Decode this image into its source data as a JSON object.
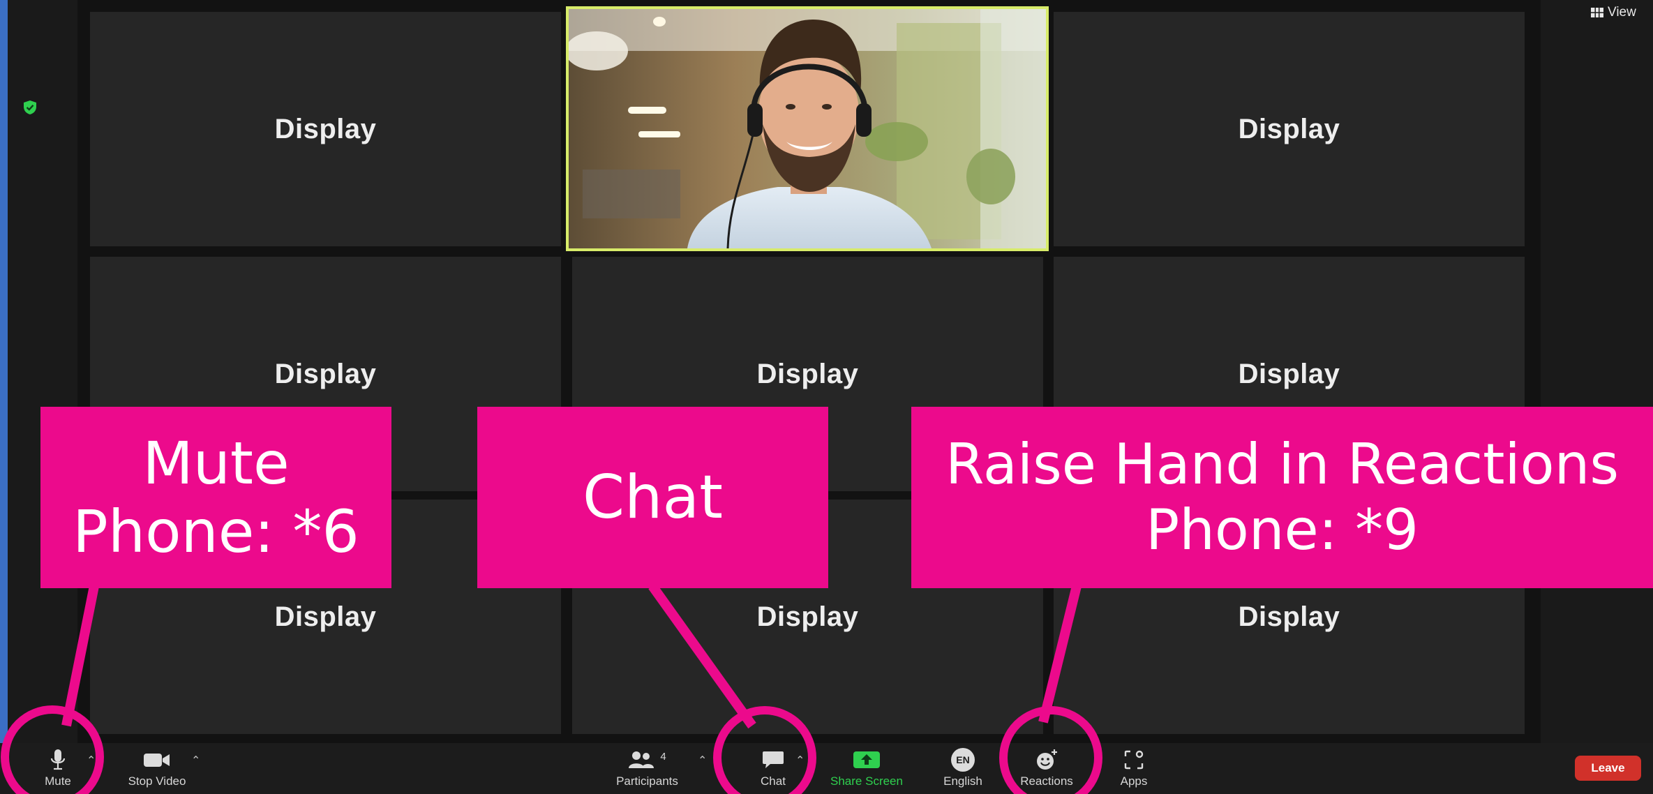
{
  "top_bar": {
    "view_label": "View",
    "view_icon": "grid-view-icon"
  },
  "tiles": [
    {
      "label": "Display"
    },
    {
      "label": "Display"
    },
    {
      "label": "Display"
    },
    {
      "label": "Display"
    },
    {
      "label": "Display"
    },
    {
      "label": "Display"
    },
    {
      "label": "Display"
    },
    {
      "label": "Display"
    }
  ],
  "active_speaker": {
    "highlight_color": "#d8ec6a"
  },
  "toolbar": {
    "mute_label": "Mute",
    "stop_video_label": "Stop Video",
    "participants_label": "Participants",
    "participants_count": "4",
    "chat_label": "Chat",
    "share_screen_label": "Share Screen",
    "language_code": "EN",
    "language_label": "English",
    "reactions_label": "Reactions",
    "apps_label": "Apps",
    "leave_label": "Leave"
  },
  "callouts": {
    "mute_line1": "Mute",
    "mute_line2": "Phone: *6",
    "chat": "Chat",
    "reactions_line1": "Raise Hand in Reactions",
    "reactions_line2": "Phone: *9"
  },
  "colors": {
    "callout": "#ec0a8c",
    "share_screen": "#2fd04f",
    "leave": "#d1312a",
    "security_shield": "#2fd04f"
  }
}
